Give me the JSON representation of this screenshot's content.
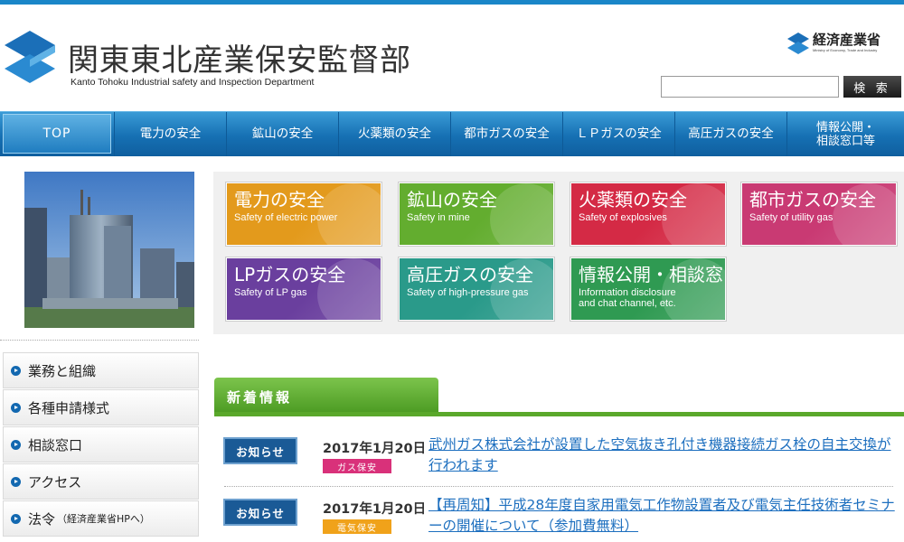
{
  "header": {
    "title": "関東東北産業保安監督部",
    "subtitle": "Kanto Tohoku Industrial safety and Inspection Department",
    "ministry_name": "経済産業省",
    "ministry_en": "Ministry of Economy, Trade and Industry",
    "search_placeholder": "",
    "search_button": "検 索"
  },
  "nav": {
    "items": [
      {
        "label": "TOP"
      },
      {
        "label": "電力の安全"
      },
      {
        "label": "鉱山の安全"
      },
      {
        "label": "火薬類の安全"
      },
      {
        "label": "都市ガスの安全"
      },
      {
        "label": "ＬＰガスの安全"
      },
      {
        "label": "高圧ガスの安全"
      },
      {
        "label": "情報公開・\n相談窓口等"
      }
    ]
  },
  "tiles": [
    {
      "jp": "電力の安全",
      "en": "Safety of electric power",
      "color": "#e39a1c"
    },
    {
      "jp": "鉱山の安全",
      "en": "Safety in mine",
      "color": "#63ad2f"
    },
    {
      "jp": "火薬類の安全",
      "en": "Safety of explosives",
      "color": "#d42a45"
    },
    {
      "jp": "都市ガスの安全",
      "en": "Safety of utility gas",
      "color": "#c93a73"
    },
    {
      "jp": "LPガスの安全",
      "en": "Safety of LP gas",
      "color": "#6a3f9e"
    },
    {
      "jp": "高圧ガスの安全",
      "en": "Safety of high-pressure gas",
      "color": "#2a9a8a"
    },
    {
      "jp": "情報公開・相談窓口等",
      "en": "Information disclosure\nand chat channel, etc.",
      "color": "#2f9a52"
    }
  ],
  "sidebar": {
    "items": [
      {
        "label": "業務と組織",
        "note": ""
      },
      {
        "label": "各種申請様式",
        "note": ""
      },
      {
        "label": "相談窓口",
        "note": ""
      },
      {
        "label": "アクセス",
        "note": ""
      },
      {
        "label": "法令",
        "note": "（経済産業省HPへ）"
      }
    ]
  },
  "news": {
    "heading": "新着情報",
    "items": [
      {
        "badge": "お知らせ",
        "date": "2017年1月20日",
        "category": "ガス保安",
        "category_color": "#d9317a",
        "title": "武州ガス株式会社が設置した空気抜き孔付き機器接続ガス栓の自主交換が行われます"
      },
      {
        "badge": "お知らせ",
        "date": "2017年1月20日",
        "category": "電気保安",
        "category_color": "#f0a21a",
        "title": "【再周知】平成28年度自家用電気工作物設置者及び電気主任技術者セミナーの開催について（参加費無料）"
      }
    ]
  }
}
